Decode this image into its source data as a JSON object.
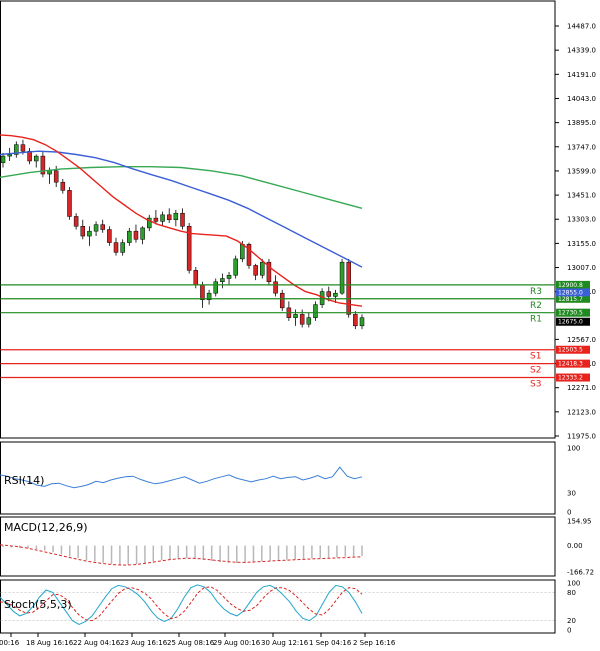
{
  "chart_data": {
    "type": "candlestick",
    "title": "",
    "colors": {
      "up": "#2ca02c",
      "down": "#d62728",
      "ma_fast": "#e8231d",
      "ma_mid": "#3a5fd6",
      "ma_slow": "#37a853",
      "resistance": "#1f8a1f",
      "support": "#e8231d",
      "rsi": "#3a7fd5",
      "macd_hist": "#b8b8b8",
      "macd_signal": "#d62728",
      "stoch_main": "#22a6c8",
      "stoch_signal": "#d62728"
    },
    "price_axis": {
      "ylim": [
        11975.0,
        14487.0
      ],
      "ticks": [
        "14487.0",
        "14339.0",
        "14191.0",
        "14043.0",
        "13895.0",
        "13747.0",
        "13599.0",
        "13451.0",
        "13303.0",
        "13155.0",
        "13007.0",
        "12859.0",
        "12567.0",
        "12419.0",
        "12271.0",
        "12123.0",
        "11975.0"
      ]
    },
    "time_labels": [
      "00:16",
      "18 Aug 16:16",
      "22 Aug 04:16",
      "23 Aug 16:16",
      "25 Aug 08:16",
      "29 Aug 00:16",
      "30 Aug 12:16",
      "1 Sep 04:16",
      "2 Sep 16:16"
    ],
    "levels": {
      "resistance": [
        {
          "name": "R3",
          "value": 12900.8,
          "tag": "12900.8"
        },
        {
          "name": "R2",
          "value": 12815.7,
          "tag": "12815.7"
        },
        {
          "name": "R1",
          "value": 12730.5,
          "tag": "12730.5"
        }
      ],
      "support": [
        {
          "name": "S1",
          "value": 12503.5,
          "tag": "12503.5"
        },
        {
          "name": "S2",
          "value": 12418.3,
          "tag": "12418.3"
        },
        {
          "name": "S3",
          "value": 12333.2,
          "tag": "12333.2"
        }
      ]
    },
    "price_tags": [
      {
        "value": 12855.0,
        "text": "12855.0",
        "color": "#3a5fd6"
      },
      {
        "value": 12675.0,
        "text": "12675.0",
        "color": "#000000"
      }
    ],
    "candles": [
      [
        13650,
        13710,
        13620,
        13690
      ],
      [
        13690,
        13740,
        13660,
        13700
      ],
      [
        13700,
        13780,
        13680,
        13760
      ],
      [
        13760,
        13790,
        13700,
        13720
      ],
      [
        13720,
        13740,
        13640,
        13660
      ],
      [
        13660,
        13700,
        13620,
        13690
      ],
      [
        13690,
        13720,
        13560,
        13580
      ],
      [
        13580,
        13620,
        13520,
        13600
      ],
      [
        13600,
        13630,
        13500,
        13530
      ],
      [
        13530,
        13550,
        13460,
        13480
      ],
      [
        13480,
        13500,
        13300,
        13320
      ],
      [
        13320,
        13340,
        13240,
        13260
      ],
      [
        13260,
        13300,
        13180,
        13200
      ],
      [
        13200,
        13260,
        13140,
        13230
      ],
      [
        13230,
        13290,
        13200,
        13270
      ],
      [
        13270,
        13300,
        13220,
        13240
      ],
      [
        13240,
        13260,
        13140,
        13160
      ],
      [
        13160,
        13190,
        13080,
        13100
      ],
      [
        13100,
        13180,
        13080,
        13160
      ],
      [
        13160,
        13250,
        13140,
        13230
      ],
      [
        13230,
        13270,
        13160,
        13180
      ],
      [
        13180,
        13260,
        13150,
        13250
      ],
      [
        13250,
        13330,
        13230,
        13310
      ],
      [
        13310,
        13360,
        13270,
        13290
      ],
      [
        13290,
        13350,
        13260,
        13330
      ],
      [
        13330,
        13370,
        13280,
        13300
      ],
      [
        13300,
        13360,
        13260,
        13340
      ],
      [
        13340,
        13370,
        13240,
        13260
      ],
      [
        13260,
        13280,
        12970,
        12990
      ],
      [
        12990,
        13010,
        12880,
        12900
      ],
      [
        12900,
        12920,
        12760,
        12810
      ],
      [
        12810,
        12870,
        12780,
        12850
      ],
      [
        12850,
        12940,
        12830,
        12920
      ],
      [
        12920,
        12970,
        12880,
        12940
      ],
      [
        12940,
        12980,
        12900,
        12960
      ],
      [
        12960,
        13080,
        12940,
        13060
      ],
      [
        13060,
        13170,
        13040,
        13150
      ],
      [
        13150,
        13160,
        13000,
        13020
      ],
      [
        13020,
        13030,
        12930,
        12960
      ],
      [
        12960,
        13060,
        12940,
        13040
      ],
      [
        13040,
        13060,
        12900,
        12920
      ],
      [
        12920,
        12960,
        12830,
        12850
      ],
      [
        12850,
        12870,
        12740,
        12760
      ],
      [
        12760,
        12800,
        12680,
        12700
      ],
      [
        12700,
        12750,
        12650,
        12720
      ],
      [
        12720,
        12750,
        12640,
        12660
      ],
      [
        12660,
        12730,
        12640,
        12700
      ],
      [
        12700,
        12800,
        12680,
        12780
      ],
      [
        12780,
        12880,
        12760,
        12860
      ],
      [
        12860,
        12890,
        12800,
        12830
      ],
      [
        12830,
        12870,
        12790,
        12850
      ],
      [
        12850,
        13060,
        12840,
        13040
      ],
      [
        13040,
        13060,
        12700,
        12720
      ],
      [
        12720,
        12740,
        12630,
        12650
      ],
      [
        12650,
        12720,
        12630,
        12700
      ]
    ],
    "ma_fast": [
      13820,
      13815,
      13805,
      13790,
      13760,
      13720,
      13670,
      13620,
      13560,
      13500,
      13440,
      13390,
      13340,
      13300,
      13270,
      13250,
      13230,
      13215,
      13210,
      13205,
      13200,
      13170,
      13120,
      13060,
      13000,
      12950,
      12900,
      12860,
      12840,
      12810,
      12790,
      12780,
      12770
    ],
    "ma_mid": [
      13700,
      13710,
      13720,
      13715,
      13700,
      13680,
      13650,
      13610,
      13575,
      13540,
      13500,
      13460,
      13420,
      13370,
      13310,
      13250,
      13190,
      13130,
      13070,
      13010
    ],
    "ma_slow": [
      13560,
      13590,
      13610,
      13620,
      13625,
      13625,
      13620,
      13600,
      13570,
      13520,
      13470,
      13420,
      13370
    ],
    "rsi": {
      "label": "RSI(14)",
      "ylim": [
        0,
        100
      ],
      "ticks": [
        "100",
        "30",
        "0"
      ],
      "values": [
        58,
        56,
        52,
        50,
        47,
        42,
        40,
        44,
        45,
        41,
        38,
        40,
        43,
        48,
        46,
        50,
        53,
        55,
        56,
        51,
        47,
        44,
        46,
        49,
        52,
        55,
        50,
        45,
        48,
        52,
        55,
        58,
        53,
        50,
        47,
        50,
        52,
        56,
        52,
        54,
        55,
        50,
        53,
        57,
        52,
        55,
        70,
        56,
        52,
        55
      ]
    },
    "macd": {
      "label": "MACD(12,26,9)",
      "ticks": [
        "154.95",
        "0.00",
        "-166.72"
      ],
      "ylim": [
        -166.72,
        154.95
      ],
      "hist": [
        -10,
        -12,
        -14,
        -18,
        -22,
        -30,
        -42,
        -55,
        -68,
        -80,
        -92,
        -100,
        -108,
        -115,
        -120,
        -122,
        -118,
        -110,
        -100,
        -92,
        -85,
        -80,
        -78,
        -82,
        -90,
        -98,
        -104,
        -108,
        -110,
        -108,
        -104,
        -100,
        -96,
        -92,
        -88,
        -86,
        -84,
        -80,
        -78,
        -76,
        -74,
        -70,
        -68,
        -66
      ],
      "signal": [
        5,
        0,
        -6,
        -14,
        -24,
        -36,
        -48,
        -60,
        -72,
        -84,
        -95,
        -104,
        -112,
        -118,
        -122,
        -123,
        -120,
        -114,
        -106,
        -98,
        -90,
        -84,
        -80,
        -80,
        -84,
        -90,
        -96,
        -101,
        -105,
        -106,
        -104,
        -101,
        -98,
        -95,
        -92,
        -89,
        -87,
        -84,
        -82,
        -80,
        -78,
        -76,
        -73,
        -71
      ]
    },
    "stoch": {
      "label": "Stoch(5,5,3)",
      "ylim": [
        0,
        100
      ],
      "ticks": [
        "100",
        "80",
        "20",
        "0"
      ],
      "main": [
        70,
        55,
        40,
        30,
        35,
        50,
        70,
        85,
        80,
        60,
        40,
        20,
        12,
        18,
        30,
        50,
        70,
        88,
        95,
        92,
        85,
        75,
        60,
        40,
        25,
        18,
        25,
        45,
        70,
        90,
        96,
        92,
        80,
        60,
        45,
        35,
        30,
        40,
        60,
        80,
        92,
        95,
        88,
        75,
        60,
        40,
        25,
        20,
        30,
        55,
        80,
        95,
        92,
        80,
        60,
        35
      ],
      "signal": [
        60,
        58,
        52,
        42,
        36,
        38,
        48,
        62,
        75,
        76,
        66,
        48,
        32,
        22,
        20,
        28,
        45,
        62,
        78,
        88,
        90,
        86,
        78,
        66,
        48,
        34,
        24,
        28,
        40,
        58,
        78,
        90,
        92,
        84,
        70,
        56,
        46,
        40,
        42,
        52,
        68,
        82,
        90,
        90,
        84,
        72,
        58,
        44,
        34,
        32,
        44,
        62,
        80,
        90,
        88,
        76
      ]
    }
  }
}
